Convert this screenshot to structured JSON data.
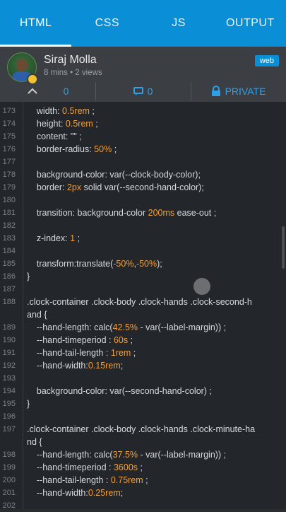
{
  "tabs": [
    {
      "label": "HTML",
      "active": true
    },
    {
      "label": "CSS",
      "active": false
    },
    {
      "label": "JS",
      "active": false
    },
    {
      "label": "OUTPUT",
      "active": false
    }
  ],
  "author": {
    "name": "Siraj Molla",
    "meta": "8 mins • 2 views",
    "tag": "web"
  },
  "actions": {
    "upvotes": "0",
    "comments": "0",
    "privacy": "PRIVATE"
  },
  "code_lines": [
    {
      "n": "173",
      "html": "    width: <span class='num'>0.5rem</span> ;"
    },
    {
      "n": "174",
      "html": "    height: <span class='num'>0.5rem</span> ;"
    },
    {
      "n": "175",
      "html": "    content: \"\" ;"
    },
    {
      "n": "176",
      "html": "    border-radius: <span class='num'>50%</span> ;"
    },
    {
      "n": "177",
      "html": ""
    },
    {
      "n": "178",
      "html": "    background-color: var(--clock-body-color);"
    },
    {
      "n": "179",
      "html": "    border: <span class='num'>2px</span> solid var(--second-hand-color);"
    },
    {
      "n": "180",
      "html": ""
    },
    {
      "n": "181",
      "html": "    transition: background-color <span class='num'>200ms</span> ease-out ;"
    },
    {
      "n": "182",
      "html": ""
    },
    {
      "n": "183",
      "html": "    z-index: <span class='num'>1</span> ;"
    },
    {
      "n": "184",
      "html": ""
    },
    {
      "n": "185",
      "html": "    transform:translate(<span class='num'>-50%</span>,<span class='num'>-50%</span>);"
    },
    {
      "n": "186",
      "html": "}"
    },
    {
      "n": "187",
      "html": ""
    },
    {
      "n": "188",
      "html": ".clock-container .clock-body .clock-hands .clock-second-h"
    },
    {
      "n": "",
      "html": "and {"
    },
    {
      "n": "189",
      "html": "    --hand-length: calc(<span class='num'>42.5%</span> - var(--label-margin)) ;"
    },
    {
      "n": "190",
      "html": "    --hand-timeperiod : <span class='num'>60s</span> ;"
    },
    {
      "n": "191",
      "html": "    --hand-tail-length : <span class='num'>1rem</span> ;"
    },
    {
      "n": "192",
      "html": "    --hand-width:<span class='num'>0.15rem</span>;"
    },
    {
      "n": "193",
      "html": ""
    },
    {
      "n": "194",
      "html": "    background-color: var(--second-hand-color) ;"
    },
    {
      "n": "195",
      "html": "}"
    },
    {
      "n": "196",
      "html": ""
    },
    {
      "n": "197",
      "html": ".clock-container .clock-body .clock-hands .clock-minute-ha"
    },
    {
      "n": "",
      "html": "nd {"
    },
    {
      "n": "198",
      "html": "    --hand-length: calc(<span class='num'>37.5%</span> - var(--label-margin)) ;"
    },
    {
      "n": "199",
      "html": "    --hand-timeperiod : <span class='num'>3600s</span> ;"
    },
    {
      "n": "200",
      "html": "    --hand-tail-length : <span class='num'>0.75rem</span> ;"
    },
    {
      "n": "201",
      "html": "    --hand-width:<span class='num'>0.25rem</span>;"
    },
    {
      "n": "202",
      "html": ""
    }
  ]
}
